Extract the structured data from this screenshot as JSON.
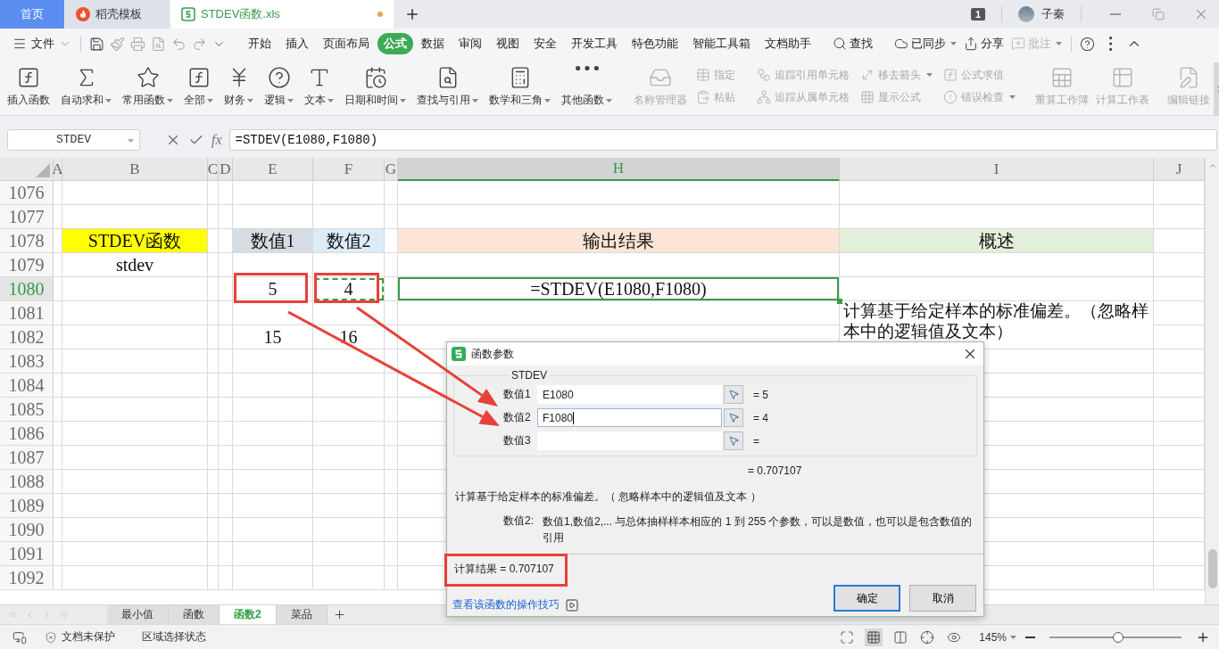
{
  "title_tabs": [
    {
      "kind": "home",
      "label": "首页",
      "selected": false
    },
    {
      "kind": "docer",
      "label": "稻壳模板",
      "selected": false
    },
    {
      "kind": "sheet",
      "label": "STDEV函数.xls",
      "selected": true,
      "unsaved": true
    }
  ],
  "account": {
    "badge": "1",
    "name": "子秦"
  },
  "file_menu": "文件",
  "menu_tabs": [
    {
      "label": "开始",
      "selected": false
    },
    {
      "label": "插入",
      "selected": false
    },
    {
      "label": "页面布局",
      "selected": false
    },
    {
      "label": "公式",
      "selected": true
    },
    {
      "label": "数据",
      "selected": false
    },
    {
      "label": "审阅",
      "selected": false
    },
    {
      "label": "视图",
      "selected": false
    },
    {
      "label": "安全",
      "selected": false
    },
    {
      "label": "开发工具",
      "selected": false
    },
    {
      "label": "特色功能",
      "selected": false
    },
    {
      "label": "智能工具箱",
      "selected": false
    },
    {
      "label": "文档助手",
      "selected": false
    }
  ],
  "menu_actions": [
    {
      "label": "查找",
      "dropdown": false,
      "disabled": false
    },
    {
      "label": "已同步",
      "dropdown": true,
      "disabled": false
    },
    {
      "label": "分享",
      "dropdown": false,
      "disabled": false
    },
    {
      "label": "批注",
      "dropdown": true,
      "disabled": true
    }
  ],
  "ribbon_functions": [
    {
      "label": "插入函数",
      "dropdown": false
    },
    {
      "label": "自动求和",
      "dropdown": true
    },
    {
      "label": "常用函数",
      "dropdown": true
    },
    {
      "label": "全部",
      "dropdown": true
    },
    {
      "label": "财务",
      "dropdown": true
    },
    {
      "label": "逻辑",
      "dropdown": true
    },
    {
      "label": "文本",
      "dropdown": true
    },
    {
      "label": "日期和时间",
      "dropdown": true
    },
    {
      "label": "查找与引用",
      "dropdown": true
    },
    {
      "label": "数学和三角",
      "dropdown": true
    },
    {
      "label": "其他函数",
      "dropdown": true
    }
  ],
  "ribbon_tools": [
    {
      "kind": "large",
      "items": [
        {
          "label": "名称管理器",
          "disabled": true,
          "dropdown": false
        }
      ]
    },
    {
      "kind": "stack",
      "items": [
        {
          "label": "指定",
          "disabled": true,
          "dropdown": false
        },
        {
          "label": "粘贴",
          "disabled": true,
          "dropdown": false
        }
      ]
    },
    {
      "kind": "stack",
      "items": [
        {
          "label": "追踪引用单元格",
          "disabled": true,
          "dropdown": false
        },
        {
          "label": "追踪从属单元格",
          "disabled": true,
          "dropdown": false
        }
      ]
    },
    {
      "kind": "stack",
      "items": [
        {
          "label": "移去箭头",
          "disabled": true,
          "dropdown": true
        },
        {
          "label": "显示公式",
          "disabled": true,
          "dropdown": false
        }
      ]
    },
    {
      "kind": "stack",
      "items": [
        {
          "label": "公式求值",
          "disabled": true,
          "dropdown": false
        },
        {
          "label": "错误检查",
          "disabled": true,
          "dropdown": true
        }
      ]
    },
    {
      "kind": "large",
      "items": [
        {
          "label": "重算工作簿",
          "disabled": true,
          "dropdown": false
        },
        {
          "label": "计算工作表",
          "disabled": true,
          "dropdown": false
        }
      ]
    },
    {
      "kind": "large",
      "items": [
        {
          "label": "编辑链接",
          "disabled": true,
          "dropdown": false
        }
      ]
    }
  ],
  "formula_bar": {
    "name_box": "STDEV",
    "fx": "fx",
    "formula": "=STDEV(E1080,F1080)"
  },
  "sheet": {
    "columns": [
      {
        "label": "A",
        "selected": false
      },
      {
        "label": "B",
        "selected": false
      },
      {
        "label": "C",
        "selected": false
      },
      {
        "label": "D",
        "selected": false
      },
      {
        "label": "E",
        "selected": false
      },
      {
        "label": "F",
        "selected": false
      },
      {
        "label": "G",
        "selected": false
      },
      {
        "label": "H",
        "selected": true
      },
      {
        "label": "I",
        "selected": false
      },
      {
        "label": "J",
        "selected": false
      }
    ],
    "rows": [
      {
        "number": "1076",
        "selected": false
      },
      {
        "number": "1077",
        "selected": false
      },
      {
        "number": "1078",
        "selected": false,
        "cells": [
          {},
          {
            "text": "STDEV函数",
            "color": "#ffff00"
          },
          {},
          {},
          {
            "text": "数值1",
            "color": "#d6dce4"
          },
          {
            "text": "数值2",
            "color": "#ddebf7"
          },
          {},
          {
            "text": "输出结果",
            "color": "#fce4d6"
          },
          {
            "text": "概述",
            "color": "#e2efda"
          },
          {}
        ]
      },
      {
        "number": "1079",
        "selected": false,
        "cells": [
          {},
          {
            "text": "stdev"
          },
          {},
          {},
          {},
          {},
          {},
          {},
          {},
          {}
        ]
      },
      {
        "number": "1080",
        "selected": true,
        "cells": [
          {},
          {},
          {},
          {},
          {
            "text": "5",
            "annotated": true
          },
          {
            "text": "4",
            "annotated": true,
            "referenced": true
          },
          {},
          {
            "text": "=STDEV(E1080,F1080)",
            "active": true
          },
          {},
          {}
        ]
      },
      {
        "number": "1081",
        "selected": false,
        "cells": [
          {},
          {},
          {},
          {},
          {},
          {},
          {},
          {},
          {
            "text": "计算基于给定样本的标准偏差。（忽略样本中的逻辑值及文本）",
            "merged": true
          },
          {}
        ]
      },
      {
        "number": "1082",
        "selected": false,
        "cells": [
          {},
          {},
          {},
          {},
          {
            "text": "15"
          },
          {
            "text": "16"
          },
          {},
          {},
          {},
          {}
        ]
      },
      {
        "number": "1083",
        "selected": false
      },
      {
        "number": "1084",
        "selected": false
      },
      {
        "number": "1085",
        "selected": false
      },
      {
        "number": "1086",
        "selected": false
      },
      {
        "number": "1087",
        "selected": false
      },
      {
        "number": "1088",
        "selected": false
      },
      {
        "number": "1089",
        "selected": false
      },
      {
        "number": "1090",
        "selected": false
      },
      {
        "number": "1091",
        "selected": false
      },
      {
        "number": "1092",
        "selected": false
      }
    ]
  },
  "dialog": {
    "title": "函数参数",
    "function": "STDEV",
    "args": [
      {
        "label": "数值1",
        "value": "E1080",
        "result": "= 5",
        "focused": false
      },
      {
        "label": "数值2",
        "value": "F1080",
        "result": "= 4",
        "focused": true
      },
      {
        "label": "数值3",
        "result": "=",
        "focused": false
      }
    ],
    "total": "= 0.707107",
    "description": "计算基于给定样本的标准偏差。（ 忽略样本中的逻辑值及文本 ）",
    "param_label": "数值2:",
    "param_help": "数值1,数值2,... 与总体抽样样本相应的 1 到 255 个参数，可以是数值，也可以是包含数值的引用",
    "result": {
      "text": "计算结果 = 0.707107",
      "annotated": true
    },
    "link": "查看该函数的操作技巧",
    "buttons": [
      {
        "label": "确定",
        "default": true
      },
      {
        "label": "取消",
        "default": false
      }
    ]
  },
  "sheet_tabs": [
    {
      "label": "最小值",
      "selected": false
    },
    {
      "label": "函数",
      "selected": false
    },
    {
      "label": "函数2",
      "selected": true
    },
    {
      "label": "菜品",
      "selected": false
    }
  ],
  "status_bar": {
    "protection": "文档未保护",
    "selection_mode": "区域选择状态",
    "zoom": "145%",
    "zoom_slider": {
      "level": 0.52
    }
  }
}
